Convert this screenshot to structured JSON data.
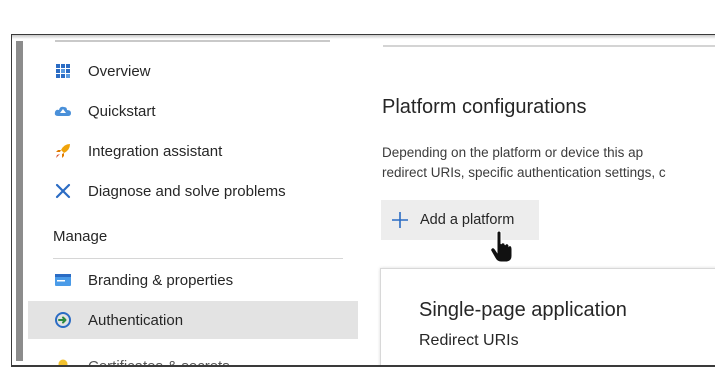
{
  "sidebar": {
    "items": [
      {
        "label": "Overview",
        "icon": "overview-grid-icon"
      },
      {
        "label": "Quickstart",
        "icon": "quickstart-cloud-icon"
      },
      {
        "label": "Integration assistant",
        "icon": "rocket-icon"
      },
      {
        "label": "Diagnose and solve problems",
        "icon": "tools-icon"
      }
    ],
    "manage_header": "Manage",
    "manage_items": [
      {
        "label": "Branding & properties",
        "icon": "branding-card-icon"
      },
      {
        "label": "Authentication",
        "icon": "authentication-icon",
        "active": true
      },
      {
        "label": "Certificates & secrets",
        "icon": "key-icon"
      }
    ]
  },
  "main": {
    "title": "Platform configurations",
    "description_line1": "Depending on the platform or device this ap",
    "description_line2": "redirect URIs, specific authentication settings, c",
    "add_platform_label": "Add a platform",
    "card": {
      "title": "Single-page application",
      "subtitle": "Redirect URIs"
    }
  },
  "colors": {
    "active_bg": "#e3e3e3",
    "button_bg": "#ededed",
    "accent_blue": "#0078d4"
  }
}
